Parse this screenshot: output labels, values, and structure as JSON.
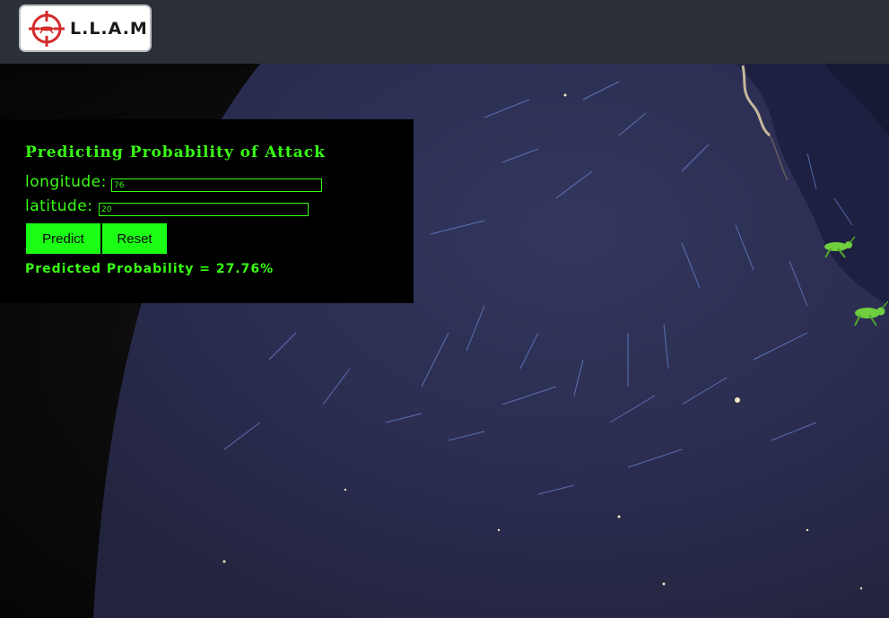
{
  "app": {
    "logo_text": "L.L.A.M",
    "icons": [
      "crosshair-locust-icon",
      "locust-icon"
    ]
  },
  "panel": {
    "title": "Predicting Probability of Attack",
    "longitude_label": "longitude:",
    "longitude_value": "76",
    "latitude_label": "latitude:",
    "latitude_value": "20",
    "predict_label": "Predict",
    "reset_label": "Reset",
    "result_text": "Predicted Probability = 27.76%"
  },
  "colors": {
    "accent": "#39ff14",
    "button": "#1aff14",
    "topbar": "#2b2f36",
    "ocean": "#2a2c4e",
    "logo_red": "#d42a2a"
  }
}
